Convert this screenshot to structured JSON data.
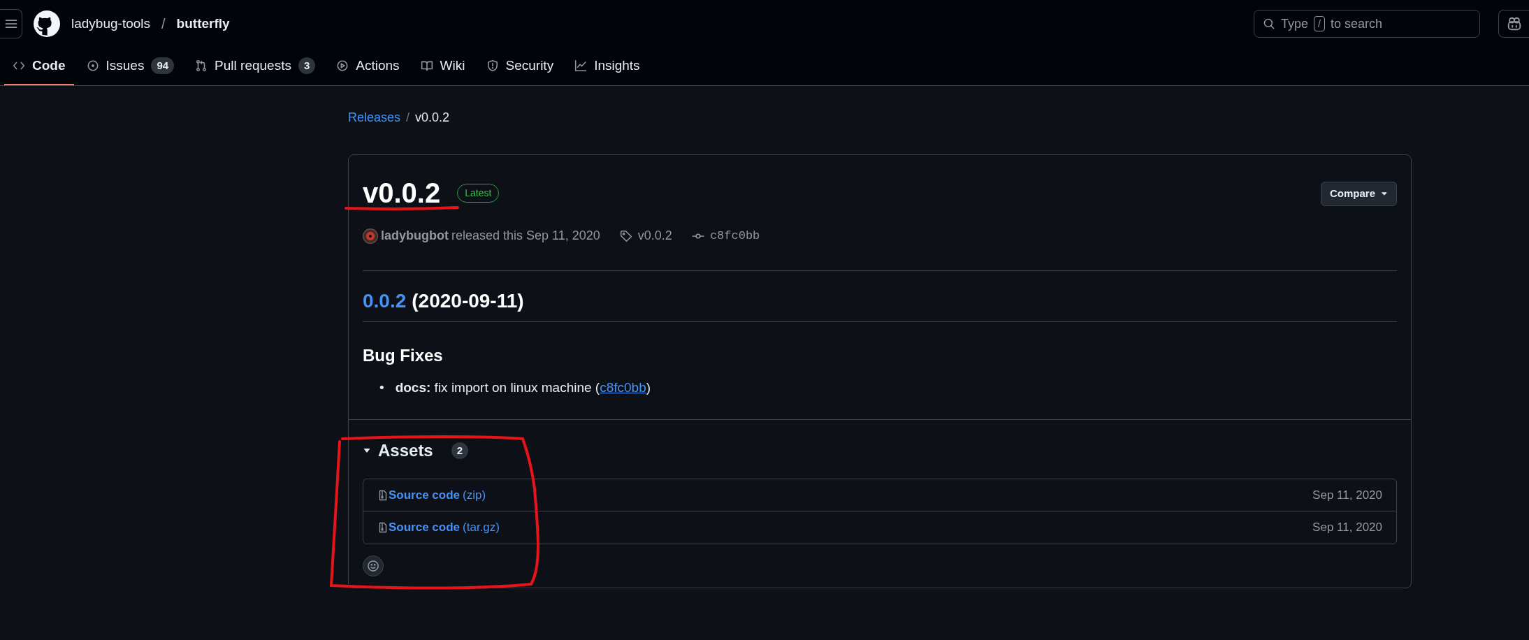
{
  "header": {
    "owner": "ladybug-tools",
    "separator": "/",
    "repo": "butterfly",
    "search": {
      "prefix": "Type",
      "key": "/",
      "suffix": "to search"
    }
  },
  "tabs": [
    {
      "label": "Code",
      "selected": true
    },
    {
      "label": "Issues",
      "count": "94",
      "selected": false
    },
    {
      "label": "Pull requests",
      "count": "3",
      "selected": false
    },
    {
      "label": "Actions",
      "selected": false
    },
    {
      "label": "Wiki",
      "selected": false
    },
    {
      "label": "Security",
      "selected": false
    },
    {
      "label": "Insights",
      "selected": false
    }
  ],
  "breadcrumb": {
    "parent": "Releases",
    "separator": "/",
    "current": "v0.0.2"
  },
  "release": {
    "title": "v0.0.2",
    "badge": "Latest",
    "compare_button": "Compare",
    "author": "ladybugbot",
    "released_text": "released this Sep 11, 2020",
    "tag": "v0.0.2",
    "commit": "c8fc0bb",
    "notes": {
      "version_link": "0.0.2",
      "date": "(2020-09-11)",
      "section": "Bug Fixes",
      "items": [
        {
          "bullet": "•",
          "text": "**docs:** fix import on linux machine (",
          "link": "c8fc0bb",
          "after": ")"
        }
      ]
    }
  },
  "assets": {
    "title": "Assets",
    "count": "2",
    "expanded": true,
    "items": [
      {
        "name": "Source code",
        "ext": "(zip)",
        "date": "Sep 11, 2020"
      },
      {
        "name": "Source code",
        "ext": "(tar.gz)",
        "date": "Sep 11, 2020"
      }
    ]
  }
}
